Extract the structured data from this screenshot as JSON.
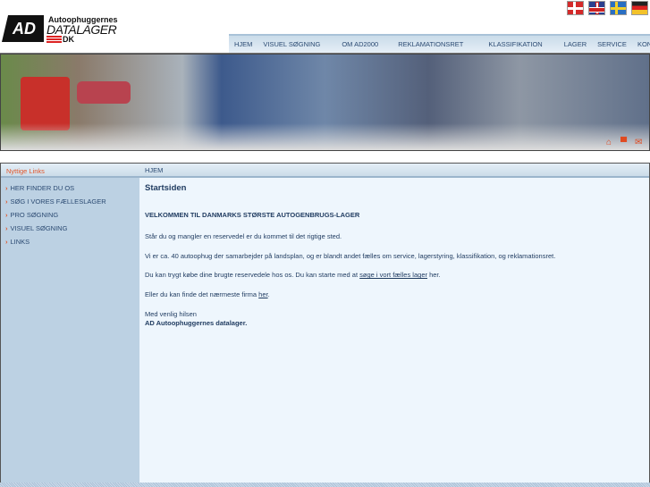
{
  "languages": [
    {
      "name": "Dansk",
      "icon": "flag-dk"
    },
    {
      "name": "English",
      "icon": "flag-uk"
    },
    {
      "name": "Svenska",
      "icon": "flag-se"
    },
    {
      "name": "Deutsch",
      "icon": "flag-de"
    }
  ],
  "logo": {
    "mark": "AD",
    "line1": "Autoophuggernes",
    "line2": "DATALAGER",
    "line3": "DK"
  },
  "nav": [
    "HJEM",
    "VISUEL SØGNING",
    "OM AD2000",
    "REKLAMATIONSRET",
    "KLASSIFIKATION",
    "LAGER",
    "SERVICE",
    "KONTAKT"
  ],
  "sidebar": {
    "title": "Nyttige Links",
    "items": [
      "HER FINDER DU OS",
      "SØG I VORES FÆLLESLAGER",
      "PRO SØGNING",
      "VISUEL SØGNING",
      "LINKS"
    ]
  },
  "breadcrumb": "HJEM",
  "main": {
    "title": "Startsiden",
    "heading": "VELKOMMEN TIL DANMARKS STØRSTE AUTOGENBRUGS-LAGER",
    "p1": "Står du og mangler en reservedel er du kommet til det rigtige sted.",
    "p2": "Vi er ca. 40 autoophug der samarbejder på landsplan, og er blandt andet fælles om service, lagerstyring, klassifikation, og reklamationsret.",
    "p3_pre": "Du kan trygt købe dine brugte reservedele hos os. Du kan starte med at ",
    "p3_link": "søge i vort fælles lager",
    "p3_post": " her.",
    "p4_pre": "Eller du kan finde det nærmeste firma ",
    "p4_link": "her",
    "p4_post": ".",
    "sign1": "Med venlig hilsen",
    "sign2": "AD Autoophuggernes datalager."
  }
}
